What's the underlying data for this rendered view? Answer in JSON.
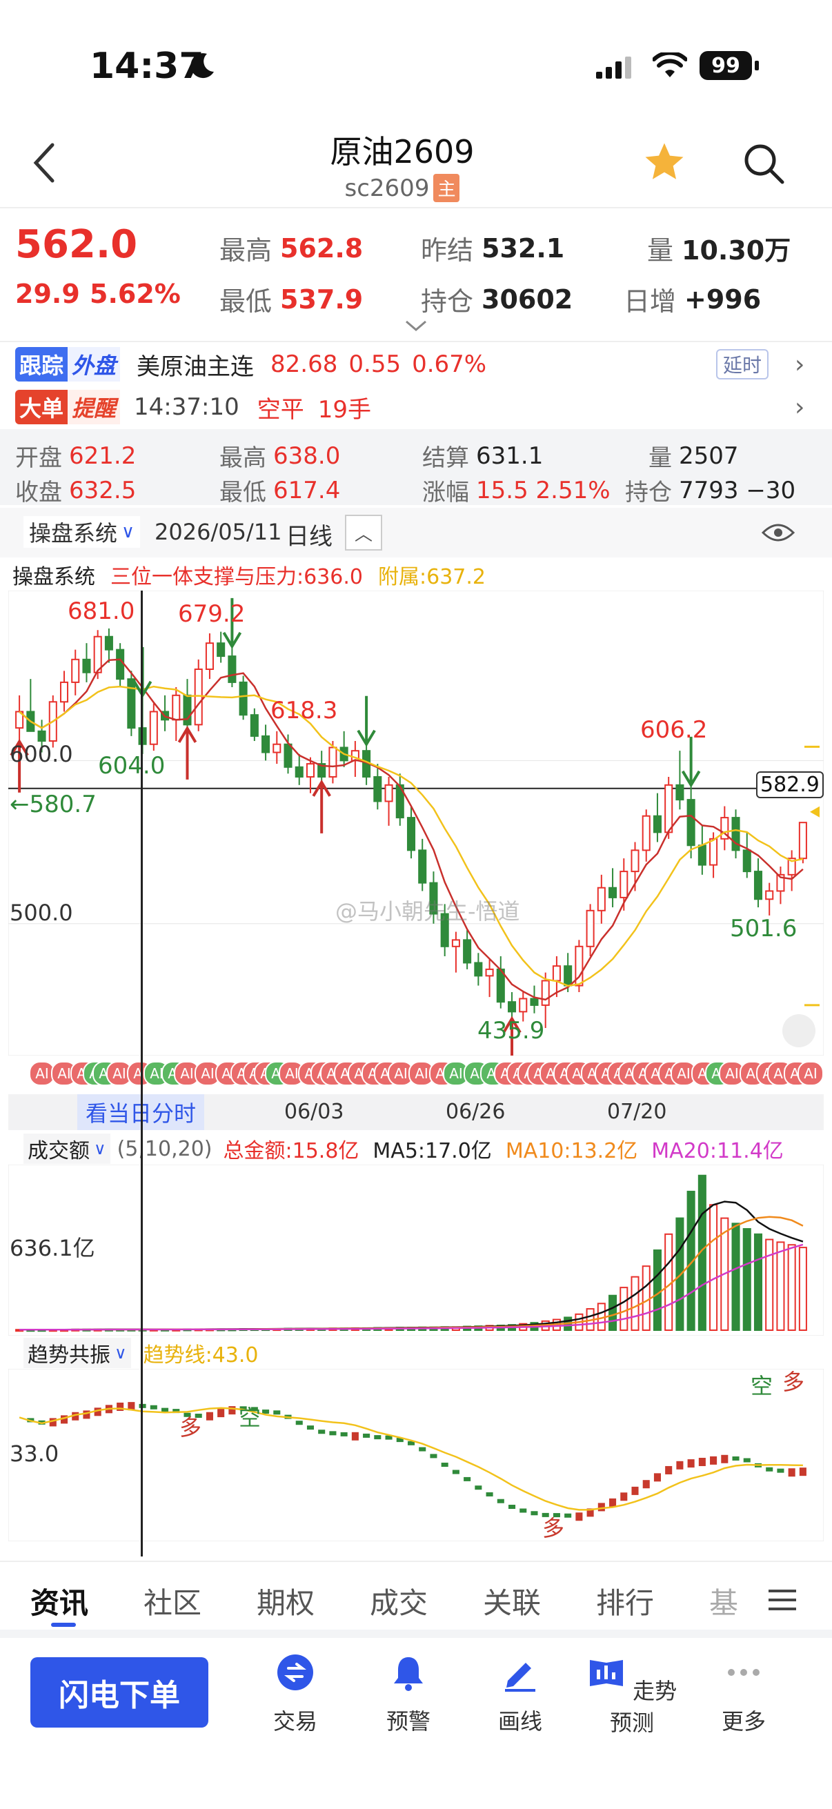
{
  "status_bar": {
    "time": "14:37",
    "battery": "99"
  },
  "header": {
    "title": "原油2609",
    "code": "sc2609",
    "main_badge": "主"
  },
  "quote": {
    "price": "562.0",
    "change": "29.9",
    "change_pct": "5.62%",
    "high_label": "最高",
    "high": "562.8",
    "low_label": "最低",
    "low": "537.9",
    "prev_settle_label": "昨结",
    "prev_settle": "532.1",
    "oi_label": "持仓",
    "oi": "30602",
    "volume_label": "量",
    "volume": "10.30万",
    "daily_inc_label": "日增",
    "daily_inc": "+996"
  },
  "tracking": {
    "badge_a": "跟踪",
    "badge_b": "外盘",
    "name": "美原油主连",
    "price": "82.68",
    "change": "0.55",
    "pct": "0.67%",
    "delay": "延时"
  },
  "bigorder": {
    "badge_a": "大单",
    "badge_b": "提醒",
    "time": "14:37:10",
    "action": "空平",
    "lots": "19手"
  },
  "daybar": {
    "open_label": "开盘",
    "open": "621.2",
    "high_label": "最高",
    "high": "638.0",
    "settle_label": "结算",
    "settle": "631.1",
    "vol_label": "量",
    "vol": "2507",
    "close_label": "收盘",
    "close": "632.5",
    "low_label": "最低",
    "low": "617.4",
    "chg_label": "涨幅",
    "chg": "15.5 2.51%",
    "oi_label": "持仓",
    "oi": "7793 −30"
  },
  "chart_toolbar": {
    "system": "操盘系统",
    "date": "2026/05/11",
    "period": "日线"
  },
  "indicator_line": {
    "name": "操盘系统",
    "support": "三位一体支撑与压力:636.0",
    "aux": "附属:637.2"
  },
  "kline_labels": {
    "y600": "600.0",
    "y500": "500.0",
    "left_mark": "←580.7",
    "cursor_price": "582.9",
    "h1": "681.0",
    "h2": "679.2",
    "h3": "618.3",
    "h4": "606.2",
    "l1": "604.0",
    "l2": "435.9",
    "l3": "501.6",
    "watermark": "@马小朝先生-悟道"
  },
  "x_axis": {
    "button": "看当日分时",
    "d1": "06/03",
    "d2": "06/26",
    "d3": "07/20"
  },
  "ai_tag": "AI",
  "volume_panel": {
    "selector": "成交额",
    "params": "(5,10,20)",
    "total": "总金额:15.8亿",
    "ma5": "MA5:17.0亿",
    "ma10": "MA10:13.2亿",
    "ma20": "MA20:11.4亿",
    "y_label": "636.1亿"
  },
  "trend_panel": {
    "selector": "趋势共振",
    "trend": "趋势线:43.0",
    "y_label": "33.0",
    "duo": "多",
    "kong": "空"
  },
  "tabs": [
    "资讯",
    "社区",
    "期权",
    "成交",
    "关联",
    "排行",
    "基"
  ],
  "bottom": {
    "flash": "闪电下单",
    "tools": [
      "交易",
      "预警",
      "画线",
      "走势预测",
      "更多"
    ]
  },
  "colors": {
    "up": "#e8302b",
    "down": "#2f8a3a",
    "accent": "#2f56e8",
    "ma_yellow": "#f2c21b",
    "ma_pink": "#d23ac8",
    "ma_orange": "#f08a1c"
  },
  "chart_data": {
    "type": "candlestick",
    "period": "daily",
    "price_axis_ticks": [
      500.0,
      600.0
    ],
    "marked_highs": [
      681.0,
      679.2,
      618.3,
      606.2
    ],
    "marked_lows": [
      604.0,
      435.9,
      501.6
    ],
    "current_line": 582.9,
    "x_ticks": [
      "06/03",
      "06/26",
      "07/20"
    ],
    "candles": [
      [
        620,
        640,
        610,
        630
      ],
      [
        630,
        650,
        622,
        618
      ],
      [
        618,
        625,
        605,
        612
      ],
      [
        612,
        640,
        608,
        636
      ],
      [
        636,
        655,
        630,
        648
      ],
      [
        648,
        668,
        640,
        662
      ],
      [
        662,
        672,
        648,
        654
      ],
      [
        654,
        680,
        650,
        676
      ],
      [
        676,
        681,
        660,
        668
      ],
      [
        668,
        672,
        645,
        650
      ],
      [
        650,
        655,
        615,
        620
      ],
      [
        620,
        640,
        604,
        610
      ],
      [
        610,
        635,
        606,
        630
      ],
      [
        630,
        640,
        618,
        625
      ],
      [
        625,
        645,
        612,
        640
      ],
      [
        640,
        650,
        618,
        622
      ],
      [
        622,
        662,
        618,
        656
      ],
      [
        656,
        678,
        650,
        672
      ],
      [
        672,
        679,
        660,
        664
      ],
      [
        664,
        670,
        645,
        648
      ],
      [
        648,
        652,
        625,
        628
      ],
      [
        628,
        632,
        612,
        615
      ],
      [
        615,
        622,
        600,
        605
      ],
      [
        605,
        618,
        598,
        610
      ],
      [
        610,
        616,
        592,
        596
      ],
      [
        596,
        604,
        585,
        590
      ],
      [
        590,
        602,
        580,
        598
      ],
      [
        598,
        606,
        585,
        590
      ],
      [
        590,
        612,
        586,
        608
      ],
      [
        608,
        618,
        596,
        600
      ],
      [
        600,
        612,
        590,
        606
      ],
      [
        606,
        610,
        585,
        590
      ],
      [
        590,
        598,
        570,
        575
      ],
      [
        575,
        590,
        560,
        585
      ],
      [
        585,
        592,
        560,
        565
      ],
      [
        565,
        572,
        540,
        545
      ],
      [
        545,
        552,
        520,
        525
      ],
      [
        525,
        532,
        500,
        506
      ],
      [
        506,
        512,
        480,
        486
      ],
      [
        486,
        495,
        470,
        490
      ],
      [
        490,
        496,
        472,
        476
      ],
      [
        476,
        482,
        462,
        468
      ],
      [
        468,
        478,
        455,
        472
      ],
      [
        472,
        480,
        448,
        452
      ],
      [
        452,
        458,
        440,
        446
      ],
      [
        446,
        458,
        440,
        454
      ],
      [
        454,
        462,
        445,
        450
      ],
      [
        450,
        470,
        436,
        465
      ],
      [
        465,
        480,
        455,
        474
      ],
      [
        474,
        482,
        458,
        462
      ],
      [
        462,
        490,
        458,
        486
      ],
      [
        486,
        512,
        480,
        508
      ],
      [
        508,
        530,
        500,
        522
      ],
      [
        522,
        534,
        510,
        516
      ],
      [
        516,
        540,
        508,
        532
      ],
      [
        532,
        550,
        520,
        545
      ],
      [
        545,
        570,
        538,
        566
      ],
      [
        566,
        580,
        550,
        556
      ],
      [
        556,
        590,
        552,
        585
      ],
      [
        585,
        606,
        570,
        576
      ],
      [
        576,
        585,
        540,
        548
      ],
      [
        548,
        560,
        530,
        536
      ],
      [
        536,
        556,
        528,
        552
      ],
      [
        552,
        572,
        545,
        565
      ],
      [
        565,
        570,
        540,
        545
      ],
      [
        545,
        556,
        528,
        532
      ],
      [
        532,
        540,
        510,
        515
      ],
      [
        515,
        525,
        505,
        520
      ],
      [
        520,
        535,
        512,
        530
      ],
      [
        530,
        545,
        520,
        540
      ],
      [
        540,
        562,
        537,
        562
      ]
    ],
    "ma_series": [
      {
        "name": "MA5"
      },
      {
        "name": "MA10"
      }
    ],
    "volume": {
      "unit": "亿",
      "y_label": 636.1,
      "total": 15.8,
      "ma5": 17.0,
      "ma10": 13.2,
      "ma20": 11.4,
      "values": [
        2,
        2,
        2,
        2,
        2,
        3,
        3,
        3,
        3,
        3,
        3,
        3,
        3,
        3,
        3,
        4,
        4,
        4,
        4,
        4,
        5,
        5,
        5,
        5,
        6,
        6,
        6,
        6,
        7,
        7,
        8,
        8,
        9,
        9,
        10,
        10,
        11,
        11,
        12,
        12,
        14,
        15,
        17,
        18,
        20,
        24,
        28,
        34,
        40,
        48,
        60,
        80,
        100,
        130,
        160,
        200,
        240,
        300,
        360,
        420,
        520,
        580,
        470,
        420,
        400,
        380,
        360,
        340,
        330,
        320,
        310
      ]
    },
    "trend": {
      "trend_line": 43.0,
      "y_label": 33.0
    }
  }
}
